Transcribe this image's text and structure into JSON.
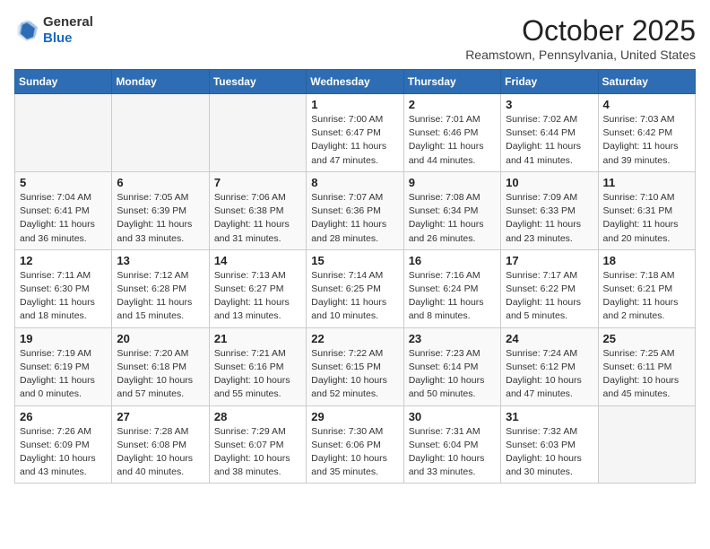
{
  "header": {
    "logo_line1": "General",
    "logo_line2": "Blue",
    "month": "October 2025",
    "location": "Reamstown, Pennsylvania, United States"
  },
  "days_of_week": [
    "Sunday",
    "Monday",
    "Tuesday",
    "Wednesday",
    "Thursday",
    "Friday",
    "Saturday"
  ],
  "weeks": [
    [
      {
        "num": "",
        "info": ""
      },
      {
        "num": "",
        "info": ""
      },
      {
        "num": "",
        "info": ""
      },
      {
        "num": "1",
        "info": "Sunrise: 7:00 AM\nSunset: 6:47 PM\nDaylight: 11 hours\nand 47 minutes."
      },
      {
        "num": "2",
        "info": "Sunrise: 7:01 AM\nSunset: 6:46 PM\nDaylight: 11 hours\nand 44 minutes."
      },
      {
        "num": "3",
        "info": "Sunrise: 7:02 AM\nSunset: 6:44 PM\nDaylight: 11 hours\nand 41 minutes."
      },
      {
        "num": "4",
        "info": "Sunrise: 7:03 AM\nSunset: 6:42 PM\nDaylight: 11 hours\nand 39 minutes."
      }
    ],
    [
      {
        "num": "5",
        "info": "Sunrise: 7:04 AM\nSunset: 6:41 PM\nDaylight: 11 hours\nand 36 minutes."
      },
      {
        "num": "6",
        "info": "Sunrise: 7:05 AM\nSunset: 6:39 PM\nDaylight: 11 hours\nand 33 minutes."
      },
      {
        "num": "7",
        "info": "Sunrise: 7:06 AM\nSunset: 6:38 PM\nDaylight: 11 hours\nand 31 minutes."
      },
      {
        "num": "8",
        "info": "Sunrise: 7:07 AM\nSunset: 6:36 PM\nDaylight: 11 hours\nand 28 minutes."
      },
      {
        "num": "9",
        "info": "Sunrise: 7:08 AM\nSunset: 6:34 PM\nDaylight: 11 hours\nand 26 minutes."
      },
      {
        "num": "10",
        "info": "Sunrise: 7:09 AM\nSunset: 6:33 PM\nDaylight: 11 hours\nand 23 minutes."
      },
      {
        "num": "11",
        "info": "Sunrise: 7:10 AM\nSunset: 6:31 PM\nDaylight: 11 hours\nand 20 minutes."
      }
    ],
    [
      {
        "num": "12",
        "info": "Sunrise: 7:11 AM\nSunset: 6:30 PM\nDaylight: 11 hours\nand 18 minutes."
      },
      {
        "num": "13",
        "info": "Sunrise: 7:12 AM\nSunset: 6:28 PM\nDaylight: 11 hours\nand 15 minutes."
      },
      {
        "num": "14",
        "info": "Sunrise: 7:13 AM\nSunset: 6:27 PM\nDaylight: 11 hours\nand 13 minutes."
      },
      {
        "num": "15",
        "info": "Sunrise: 7:14 AM\nSunset: 6:25 PM\nDaylight: 11 hours\nand 10 minutes."
      },
      {
        "num": "16",
        "info": "Sunrise: 7:16 AM\nSunset: 6:24 PM\nDaylight: 11 hours\nand 8 minutes."
      },
      {
        "num": "17",
        "info": "Sunrise: 7:17 AM\nSunset: 6:22 PM\nDaylight: 11 hours\nand 5 minutes."
      },
      {
        "num": "18",
        "info": "Sunrise: 7:18 AM\nSunset: 6:21 PM\nDaylight: 11 hours\nand 2 minutes."
      }
    ],
    [
      {
        "num": "19",
        "info": "Sunrise: 7:19 AM\nSunset: 6:19 PM\nDaylight: 11 hours\nand 0 minutes."
      },
      {
        "num": "20",
        "info": "Sunrise: 7:20 AM\nSunset: 6:18 PM\nDaylight: 10 hours\nand 57 minutes."
      },
      {
        "num": "21",
        "info": "Sunrise: 7:21 AM\nSunset: 6:16 PM\nDaylight: 10 hours\nand 55 minutes."
      },
      {
        "num": "22",
        "info": "Sunrise: 7:22 AM\nSunset: 6:15 PM\nDaylight: 10 hours\nand 52 minutes."
      },
      {
        "num": "23",
        "info": "Sunrise: 7:23 AM\nSunset: 6:14 PM\nDaylight: 10 hours\nand 50 minutes."
      },
      {
        "num": "24",
        "info": "Sunrise: 7:24 AM\nSunset: 6:12 PM\nDaylight: 10 hours\nand 47 minutes."
      },
      {
        "num": "25",
        "info": "Sunrise: 7:25 AM\nSunset: 6:11 PM\nDaylight: 10 hours\nand 45 minutes."
      }
    ],
    [
      {
        "num": "26",
        "info": "Sunrise: 7:26 AM\nSunset: 6:09 PM\nDaylight: 10 hours\nand 43 minutes."
      },
      {
        "num": "27",
        "info": "Sunrise: 7:28 AM\nSunset: 6:08 PM\nDaylight: 10 hours\nand 40 minutes."
      },
      {
        "num": "28",
        "info": "Sunrise: 7:29 AM\nSunset: 6:07 PM\nDaylight: 10 hours\nand 38 minutes."
      },
      {
        "num": "29",
        "info": "Sunrise: 7:30 AM\nSunset: 6:06 PM\nDaylight: 10 hours\nand 35 minutes."
      },
      {
        "num": "30",
        "info": "Sunrise: 7:31 AM\nSunset: 6:04 PM\nDaylight: 10 hours\nand 33 minutes."
      },
      {
        "num": "31",
        "info": "Sunrise: 7:32 AM\nSunset: 6:03 PM\nDaylight: 10 hours\nand 30 minutes."
      },
      {
        "num": "",
        "info": ""
      }
    ]
  ]
}
